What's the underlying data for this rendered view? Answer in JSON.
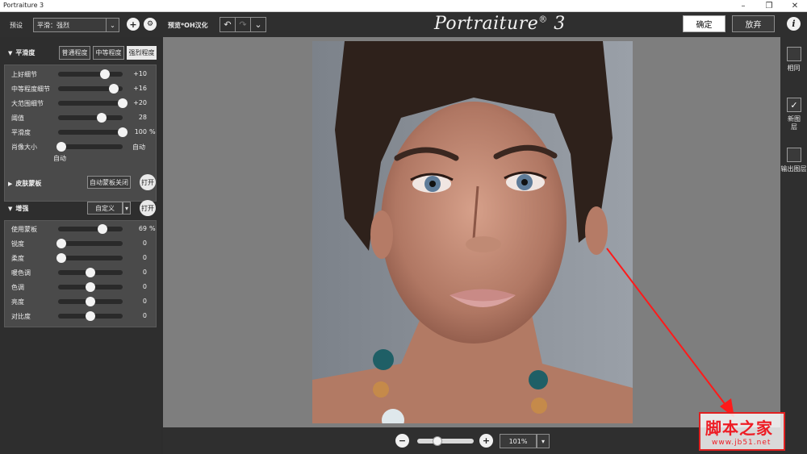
{
  "window": {
    "title": "Portraiture 3"
  },
  "toolbar": {
    "preset_label": "预设",
    "preset_value": "平滑：强烈",
    "preview_label": "预览*OH汉化",
    "logo_text": "Portraiture",
    "logo_reg": "®",
    "logo_num": "3",
    "ok_label": "确定",
    "cancel_label": "放弃",
    "info_icon": "i"
  },
  "smoothing": {
    "title": "平滑度",
    "tabs": [
      "普通程度",
      "中等程度",
      "强烈程度"
    ],
    "active_tab": 2,
    "sliders": [
      {
        "label": "上好细节",
        "value": "+10",
        "level": 0.72
      },
      {
        "label": "中等程度细节",
        "value": "+16",
        "level": 0.86
      },
      {
        "label": "大范围细节",
        "value": "+20",
        "level": 1.0
      },
      {
        "label": "阈值",
        "value": "28",
        "level": 0.68
      },
      {
        "label": "平滑度",
        "value": "100",
        "unit": "%",
        "level": 1.0
      }
    ],
    "portrait_size": {
      "label": "肖像大小",
      "value": "自动",
      "sub": "自动",
      "level": 0.05
    }
  },
  "skin_mask": {
    "title": "皮肤蒙板",
    "auto_button": "自动蒙板关闭",
    "open_button": "打开"
  },
  "enhance": {
    "title": "增强",
    "dropdown": "自定义",
    "open_button": "打开",
    "sliders": [
      {
        "label": "使用蒙板",
        "value": "69",
        "unit": "%",
        "level": 0.69
      },
      {
        "label": "锐度",
        "value": "0",
        "level": 0.05
      },
      {
        "label": "柔度",
        "value": "0",
        "level": 0.05
      },
      {
        "label": "暖色调",
        "value": "0",
        "level": 0.5
      },
      {
        "label": "色调",
        "value": "0",
        "level": 0.5
      },
      {
        "label": "亮度",
        "value": "0",
        "level": 0.5
      },
      {
        "label": "对比度",
        "value": "0",
        "level": 0.5
      }
    ]
  },
  "zoom": {
    "value": "101%",
    "level": 0.35
  },
  "right_panel": {
    "items": [
      {
        "label": "相同",
        "checked": false
      },
      {
        "label": "新图层",
        "checked": true
      },
      {
        "label": "输出图层",
        "checked": false
      }
    ]
  },
  "watermark": {
    "main": "脚本之家",
    "sub": "www.jb51.net"
  },
  "colors": {
    "accent_red": "#e02020",
    "panel_bg": "#2e2e2e",
    "canvas_bg": "#7e7e7e"
  }
}
